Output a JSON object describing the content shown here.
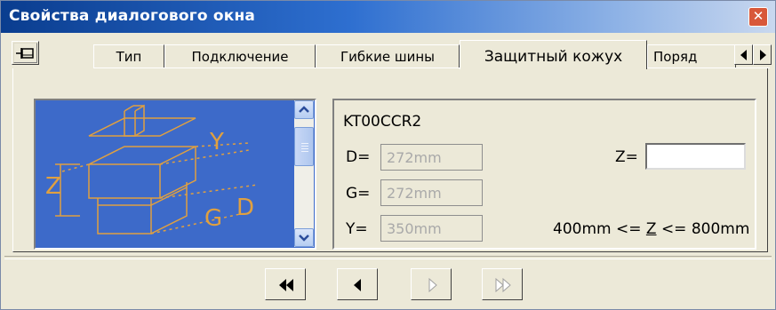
{
  "window": {
    "title": "Свойства диалогового окна",
    "close_glyph": "✕"
  },
  "toolbar": {
    "pin_icon": "pin-icon"
  },
  "tabs": [
    {
      "label": "Тип",
      "active": false
    },
    {
      "label": "Подключение",
      "active": false
    },
    {
      "label": "Гибкие шины",
      "active": false
    },
    {
      "label": "Защитный кожух",
      "active": true
    },
    {
      "label": "Поряд",
      "active": false
    }
  ],
  "tab_scroll": {
    "left_icon": "arrow-left-icon",
    "right_icon": "arrow-right-icon"
  },
  "preview": {
    "labels": {
      "y": "Y",
      "z": "Z",
      "g": "G",
      "d": "D"
    },
    "colors": {
      "background": "#3d6ac9",
      "lines": "#e0a040"
    }
  },
  "params": {
    "code": "KT00CCR2",
    "d_label": "D=",
    "d_value": "272mm",
    "g_label": "G=",
    "g_value": "272mm",
    "y_label": "Y=",
    "y_value": "350mm",
    "z_label": "Z=",
    "z_value": "",
    "range_prefix": "400mm <=",
    "range_var": "Z",
    "range_suffix": "<= 800mm"
  },
  "navigation": {
    "first_icon": "rewind-icon",
    "prev_icon": "prev-icon",
    "next_icon": "next-icon",
    "last_icon": "fast-forward-icon"
  }
}
